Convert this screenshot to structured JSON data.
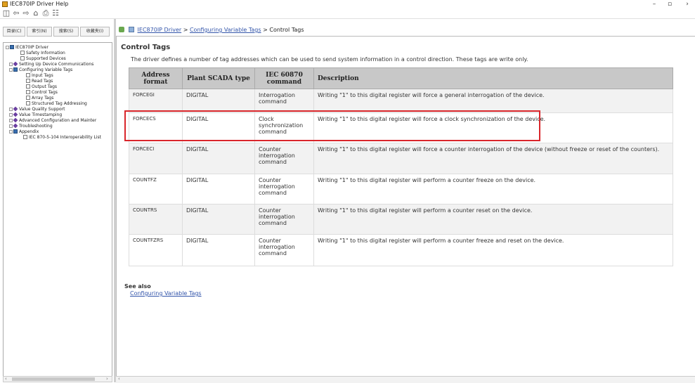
{
  "window": {
    "title": "IEC870IP Driver Help",
    "minimize_icon": "minimize-icon",
    "maximize_icon": "maximize-icon",
    "close_icon": "close-icon"
  },
  "toolbar": {
    "buttons": [
      "hide-pane-icon",
      "back-icon",
      "forward-icon",
      "home-icon",
      "print-icon",
      "options-icon"
    ]
  },
  "left_tabs": [
    "目录(C)",
    "索引(N)",
    "搜索(S)",
    "收藏夹(I)"
  ],
  "tree": [
    {
      "label": "IEC870IP Driver",
      "icon": "book-icon",
      "toggle": "minus"
    },
    {
      "label": "Safety Information",
      "icon": "page-icon"
    },
    {
      "label": "Supported Devices",
      "icon": "page-icon"
    },
    {
      "label": "Setting Up Device Communications",
      "icon": "diamond-icon",
      "toggle": "plus"
    },
    {
      "label": "Configuring Variable Tags",
      "icon": "book-icon",
      "toggle": "minus"
    },
    {
      "label": "Input Tags",
      "icon": "page-icon"
    },
    {
      "label": "Read Tags",
      "icon": "page-icon"
    },
    {
      "label": "Output Tags",
      "icon": "page-icon"
    },
    {
      "label": "Control Tags",
      "icon": "page-icon"
    },
    {
      "label": "Array Tags",
      "icon": "page-icon"
    },
    {
      "label": "Structured Tag Addressing",
      "icon": "page-icon"
    },
    {
      "label": "Value Quality Support",
      "icon": "diamond-icon",
      "toggle": "plus"
    },
    {
      "label": "Value Timestamping",
      "icon": "diamond-icon",
      "toggle": "plus"
    },
    {
      "label": "Advanced Configuration and Mainter",
      "icon": "diamond-icon",
      "toggle": "plus"
    },
    {
      "label": "Troubleshooting",
      "icon": "diamond-icon",
      "toggle": "plus"
    },
    {
      "label": "Appendix",
      "icon": "book-icon",
      "toggle": "minus"
    },
    {
      "label": "IEC 870-5-104 Interoperability List",
      "icon": "page-icon"
    }
  ],
  "breadcrumb": {
    "link1": "IEC870IP Driver",
    "sep1": ">",
    "link2": "Configuring Variable Tags",
    "sep2": ">",
    "current": "Control Tags"
  },
  "page": {
    "heading": "Control Tags",
    "intro": "The driver defines a number of tag addresses which can be used to send system information in a control direction. These tags are write only.",
    "see_also": "See also",
    "see_also_link": "Configuring Variable Tags"
  },
  "table": {
    "headers": [
      "Address format",
      "Plant SCADA type",
      "IEC 60870 command",
      "Description"
    ],
    "rows": [
      {
        "address": "FORCEGI",
        "type": "DIGITAL",
        "command": "Interrogation command",
        "description": "Writing \"1\" to this digital register will force a general interrogation of the device."
      },
      {
        "address": "FORCECS",
        "type": "DIGITAL",
        "command": "Clock synchronization command",
        "description": "Writing \"1\" to this digital register will force a clock synchronization of the device."
      },
      {
        "address": "FORCECI",
        "type": "DIGITAL",
        "command": "Counter interrogation command",
        "description": "Writing \"1\" to this digital register will force a counter interrogation of the device (without freeze or reset of the counters)."
      },
      {
        "address": "COUNTFZ",
        "type": "DIGITAL",
        "command": "Counter interrogation command",
        "description": "Writing \"1\" to this digital register will perform a counter freeze on the device."
      },
      {
        "address": "COUNTRS",
        "type": "DIGITAL",
        "command": "Counter interrogation command",
        "description": "Writing \"1\" to this digital register will perform a counter reset on the device."
      },
      {
        "address": "COUNTFZRS",
        "type": "DIGITAL",
        "command": "Counter interrogation command",
        "description": "Writing \"1\" to this digital register will perform a counter freeze and reset on the device."
      }
    ],
    "highlighted_row": 1,
    "highlight_color": "#d9262b"
  }
}
